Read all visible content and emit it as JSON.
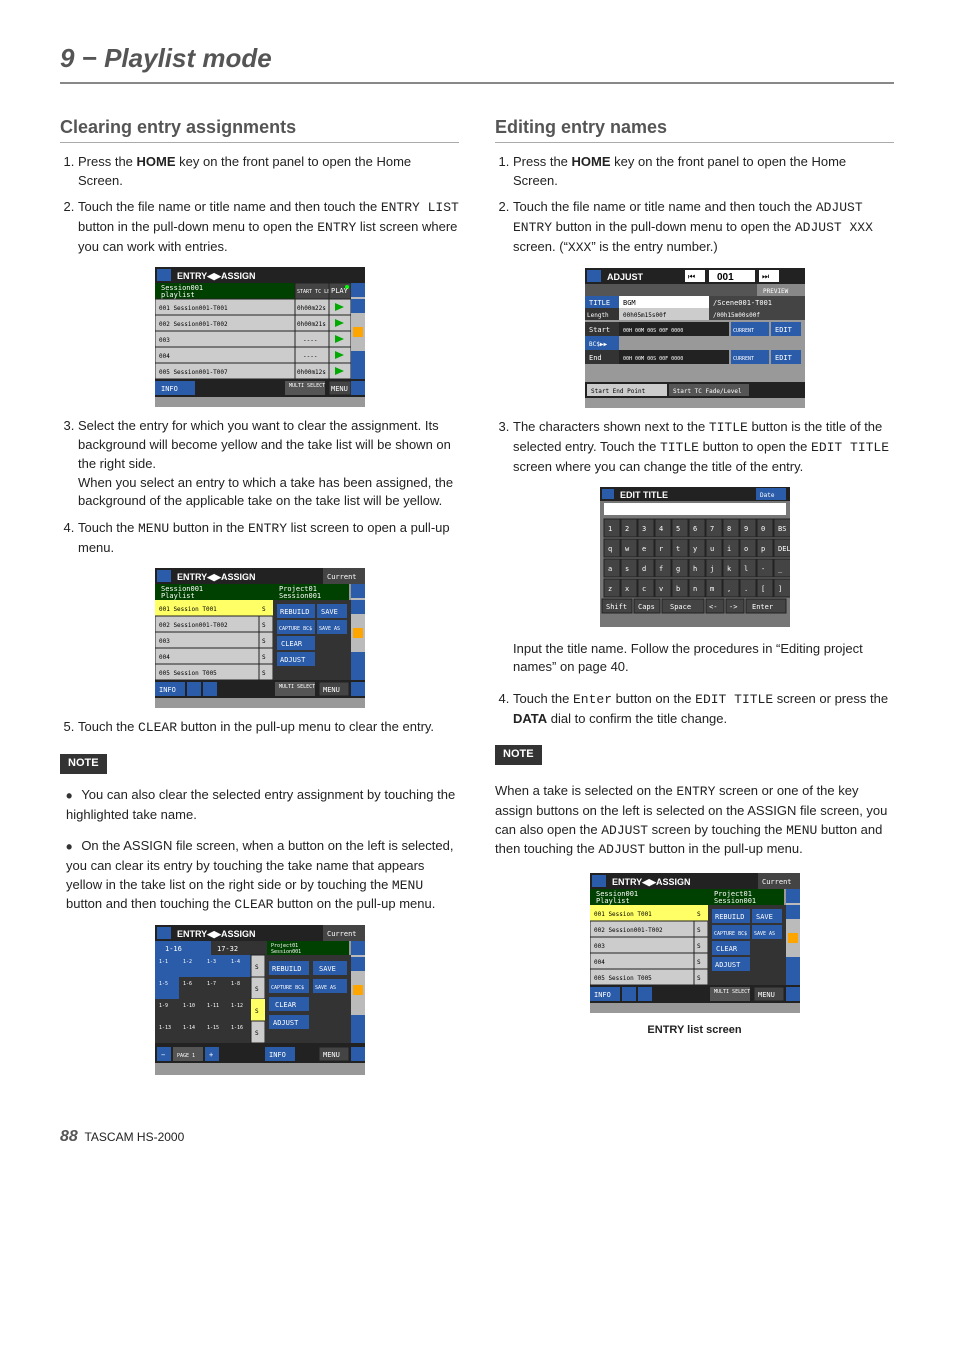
{
  "chapter": "9 − Playlist mode",
  "footer": {
    "page": "88",
    "model": "TASCAM  HS-2000"
  },
  "left": {
    "heading": "Clearing entry assignments",
    "steps": [
      "Press the <b>HOME</b> key on the front panel to open the Home Screen.",
      "Touch the file name or title name and then touch the <m>ENTRY LIST</m> button in the pull-down menu to open the <m>ENTRY</m> list screen where you can work with entries.",
      "Select the entry for which you want to clear the assignment. Its background will become yellow and the take list will be shown on the right side. When you select an entry to which a take has been assigned, the background of the applicable take on the take list will be yellow.",
      "Touch the <m>MENU</m> button in the <m>ENTRY</m> list screen to open a pull-up menu.",
      "Touch the <m>CLEAR</m> button in the pull-up menu to clear the entry."
    ],
    "note_label": "NOTE",
    "notes": [
      "You can also clear the selected entry assignment by touching the highlighted take name.",
      "On the ASSIGN file screen, when a button on the left is selected, you can clear its entry by touching the take name that appears yellow in the take list on the right side or by touching the <m>MENU</m> button and then touching the <m>CLEAR</m> button on the pull-up menu."
    ],
    "shot1": {
      "title": "ENTRY◀▶ASSIGN",
      "head1": "Session001",
      "head2": "playlist",
      "col_label": "START TC LENGTH",
      "rows": [
        [
          "001 Session001-T001",
          "0h00m22s"
        ],
        [
          "002 Session001-T002",
          "0h00m21s"
        ],
        [
          "003",
          "----"
        ],
        [
          "004",
          "----"
        ],
        [
          "005 Session001-T007",
          "0h00m12s"
        ]
      ],
      "play": "PLAY",
      "info": "INFO",
      "multi": "MULTI SELECT",
      "menu": "MENU"
    },
    "shot2": {
      "title": "ENTRY◀▶ASSIGN",
      "current": "Current",
      "head1": "Session001",
      "head2": "Playlist",
      "proj": "Project01",
      "sess": "Session001",
      "rows": [
        "001 Session T001",
        "002 Session001-T002",
        "003",
        "004",
        "005 Session T005"
      ],
      "buttons": [
        "REBUILD",
        "SAVE",
        "CAPTURE BC$",
        "SAVE AS",
        "CLEAR",
        "ADJUST"
      ],
      "info": "INFO",
      "multi": "MULTI SELECT",
      "menu": "MENU"
    },
    "shot3": {
      "title": "ENTRY◀▶ASSIGN",
      "current": "Current",
      "tabs": [
        "1-16",
        "17-32"
      ],
      "proj": "Project01",
      "sess": "Session001",
      "grid": [
        "1-1",
        "1-2",
        "1-3",
        "1-4",
        "1-5",
        "1-6",
        "1-7",
        "1-8",
        "1-9",
        "1-10",
        "1-11",
        "1-12",
        "1-13",
        "1-14",
        "1-15",
        "1-16"
      ],
      "buttons": [
        "REBUILD",
        "SAVE",
        "CAPTURE BC$",
        "SAVE AS",
        "CLEAR",
        "ADJUST"
      ],
      "page": "PAGE 1",
      "info": "INFO",
      "menu": "MENU"
    }
  },
  "right": {
    "heading": "Editing entry names",
    "steps": [
      "Press the <b>HOME</b> key on the front panel to open the Home Screen.",
      "Touch the file name or title name and then touch the <m>ADJUST ENTRY</m> button in the pull-down menu to open the <m>ADJUST XXX</m> screen. (\"<m>XXX</m>\" is the entry number.)",
      "The characters shown next to the <m>TITLE</m> button is the title of the selected entry. Touch the <m>TITLE</m> button to open the <m>EDIT TITLE</m> screen where you can change the title of the entry.",
      "Touch the <m>Enter</m> button on the <m>EDIT TITLE</m> screen or press the <b>DATA</b> dial to confirm the title change."
    ],
    "after3": "Input the title name. Follow the procedures in “Editing project names” on page 40.",
    "note_label": "NOTE",
    "note_text": "When a take is selected on the <m>ENTRY</m> screen or one of the key assign buttons on the left is selected on the ASSIGN file screen, you can also open the <m>ADJUST</m> screen by touching the <m>MENU</m> button and then touching the <m>ADJUST</m> button in the pull-up menu.",
    "shot1": {
      "title": "ADJUST",
      "entry": "001",
      "preview": "PREVIEW",
      "rows": {
        "title_label": "TITLE",
        "title_val": "BGM",
        "scene": "/Scene001-T001",
        "len_label": "Length",
        "len_val": "00h05m15s00f",
        "len_tot": "/00h15m00s00f",
        "start_label": "Start",
        "start_tc": "00H 00M 00S 00F 0000",
        "bcs": "BC$▶▶",
        "end_label": "End",
        "end_tc": "00H 00M 00S 00F 0000",
        "cur": "CURRENT",
        "edit": "EDIT",
        "sep": "Start End Point",
        "fade": "Start TC Fade/Level"
      }
    },
    "shot2": {
      "title": "EDIT TITLE",
      "date": "Date",
      "rows": [
        [
          "1",
          "2",
          "3",
          "4",
          "5",
          "6",
          "7",
          "8",
          "9",
          "0",
          "BS"
        ],
        [
          "q",
          "w",
          "e",
          "r",
          "t",
          "y",
          "u",
          "i",
          "o",
          "p",
          "DEL"
        ],
        [
          "a",
          "s",
          "d",
          "f",
          "g",
          "h",
          "j",
          "k",
          "l",
          "-",
          "_"
        ],
        [
          "z",
          "x",
          "c",
          "v",
          "b",
          "n",
          "m",
          ",",
          ".",
          "[",
          "]"
        ]
      ],
      "bottom": [
        "Shift",
        "Caps",
        "Space",
        "<-",
        "->",
        "Enter"
      ]
    },
    "shot3": {
      "title": "ENTRY◀▶ASSIGN",
      "current": "Current",
      "head1": "Session001",
      "head2": "Playlist",
      "proj": "Project01",
      "sess": "Session001",
      "rows": [
        "001 Session T001",
        "002 Session001-T002",
        "003",
        "004",
        "005 Session T005"
      ],
      "buttons": [
        "REBUILD",
        "SAVE",
        "CAPTURE BC$",
        "SAVE AS",
        "CLEAR",
        "ADJUST"
      ],
      "info": "INFO",
      "multi": "MULTI SELECT",
      "menu": "MENU",
      "caption": "ENTRY list screen"
    }
  }
}
